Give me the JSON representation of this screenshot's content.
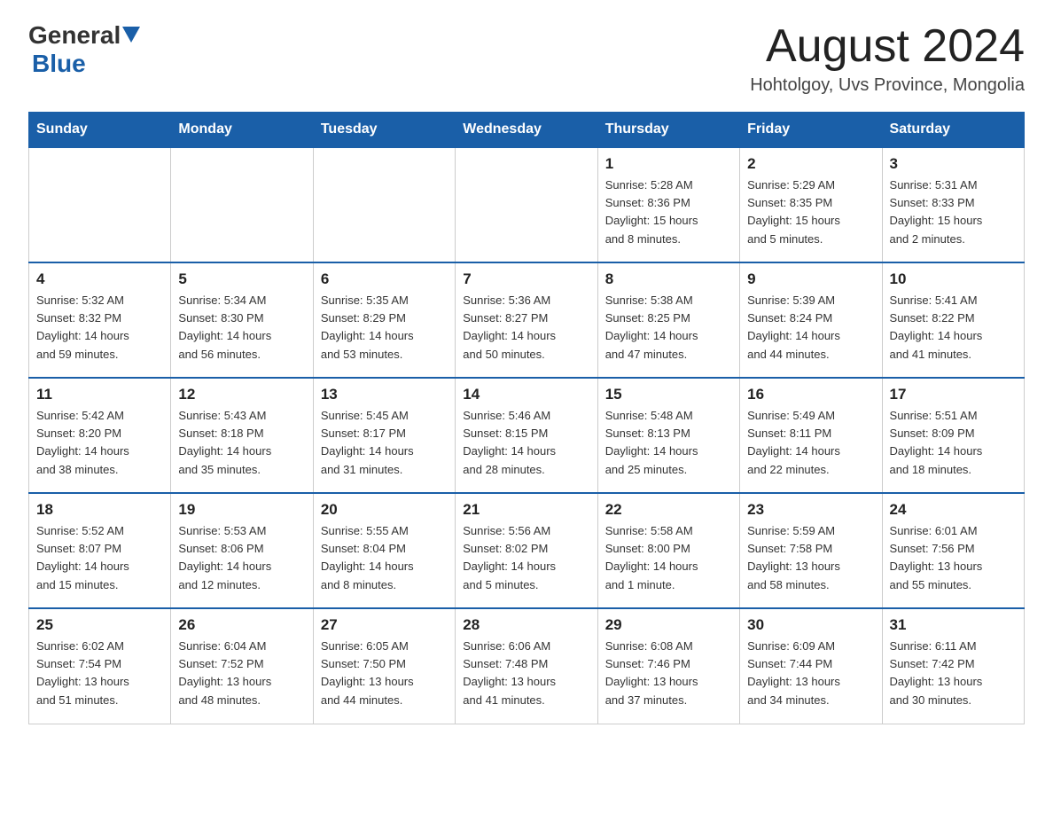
{
  "header": {
    "logo_general": "General",
    "logo_blue": "Blue",
    "month_title": "August 2024",
    "location": "Hohtolgoy, Uvs Province, Mongolia"
  },
  "columns": [
    "Sunday",
    "Monday",
    "Tuesday",
    "Wednesday",
    "Thursday",
    "Friday",
    "Saturday"
  ],
  "weeks": [
    [
      {
        "day": "",
        "info": ""
      },
      {
        "day": "",
        "info": ""
      },
      {
        "day": "",
        "info": ""
      },
      {
        "day": "",
        "info": ""
      },
      {
        "day": "1",
        "info": "Sunrise: 5:28 AM\nSunset: 8:36 PM\nDaylight: 15 hours\nand 8 minutes."
      },
      {
        "day": "2",
        "info": "Sunrise: 5:29 AM\nSunset: 8:35 PM\nDaylight: 15 hours\nand 5 minutes."
      },
      {
        "day": "3",
        "info": "Sunrise: 5:31 AM\nSunset: 8:33 PM\nDaylight: 15 hours\nand 2 minutes."
      }
    ],
    [
      {
        "day": "4",
        "info": "Sunrise: 5:32 AM\nSunset: 8:32 PM\nDaylight: 14 hours\nand 59 minutes."
      },
      {
        "day": "5",
        "info": "Sunrise: 5:34 AM\nSunset: 8:30 PM\nDaylight: 14 hours\nand 56 minutes."
      },
      {
        "day": "6",
        "info": "Sunrise: 5:35 AM\nSunset: 8:29 PM\nDaylight: 14 hours\nand 53 minutes."
      },
      {
        "day": "7",
        "info": "Sunrise: 5:36 AM\nSunset: 8:27 PM\nDaylight: 14 hours\nand 50 minutes."
      },
      {
        "day": "8",
        "info": "Sunrise: 5:38 AM\nSunset: 8:25 PM\nDaylight: 14 hours\nand 47 minutes."
      },
      {
        "day": "9",
        "info": "Sunrise: 5:39 AM\nSunset: 8:24 PM\nDaylight: 14 hours\nand 44 minutes."
      },
      {
        "day": "10",
        "info": "Sunrise: 5:41 AM\nSunset: 8:22 PM\nDaylight: 14 hours\nand 41 minutes."
      }
    ],
    [
      {
        "day": "11",
        "info": "Sunrise: 5:42 AM\nSunset: 8:20 PM\nDaylight: 14 hours\nand 38 minutes."
      },
      {
        "day": "12",
        "info": "Sunrise: 5:43 AM\nSunset: 8:18 PM\nDaylight: 14 hours\nand 35 minutes."
      },
      {
        "day": "13",
        "info": "Sunrise: 5:45 AM\nSunset: 8:17 PM\nDaylight: 14 hours\nand 31 minutes."
      },
      {
        "day": "14",
        "info": "Sunrise: 5:46 AM\nSunset: 8:15 PM\nDaylight: 14 hours\nand 28 minutes."
      },
      {
        "day": "15",
        "info": "Sunrise: 5:48 AM\nSunset: 8:13 PM\nDaylight: 14 hours\nand 25 minutes."
      },
      {
        "day": "16",
        "info": "Sunrise: 5:49 AM\nSunset: 8:11 PM\nDaylight: 14 hours\nand 22 minutes."
      },
      {
        "day": "17",
        "info": "Sunrise: 5:51 AM\nSunset: 8:09 PM\nDaylight: 14 hours\nand 18 minutes."
      }
    ],
    [
      {
        "day": "18",
        "info": "Sunrise: 5:52 AM\nSunset: 8:07 PM\nDaylight: 14 hours\nand 15 minutes."
      },
      {
        "day": "19",
        "info": "Sunrise: 5:53 AM\nSunset: 8:06 PM\nDaylight: 14 hours\nand 12 minutes."
      },
      {
        "day": "20",
        "info": "Sunrise: 5:55 AM\nSunset: 8:04 PM\nDaylight: 14 hours\nand 8 minutes."
      },
      {
        "day": "21",
        "info": "Sunrise: 5:56 AM\nSunset: 8:02 PM\nDaylight: 14 hours\nand 5 minutes."
      },
      {
        "day": "22",
        "info": "Sunrise: 5:58 AM\nSunset: 8:00 PM\nDaylight: 14 hours\nand 1 minute."
      },
      {
        "day": "23",
        "info": "Sunrise: 5:59 AM\nSunset: 7:58 PM\nDaylight: 13 hours\nand 58 minutes."
      },
      {
        "day": "24",
        "info": "Sunrise: 6:01 AM\nSunset: 7:56 PM\nDaylight: 13 hours\nand 55 minutes."
      }
    ],
    [
      {
        "day": "25",
        "info": "Sunrise: 6:02 AM\nSunset: 7:54 PM\nDaylight: 13 hours\nand 51 minutes."
      },
      {
        "day": "26",
        "info": "Sunrise: 6:04 AM\nSunset: 7:52 PM\nDaylight: 13 hours\nand 48 minutes."
      },
      {
        "day": "27",
        "info": "Sunrise: 6:05 AM\nSunset: 7:50 PM\nDaylight: 13 hours\nand 44 minutes."
      },
      {
        "day": "28",
        "info": "Sunrise: 6:06 AM\nSunset: 7:48 PM\nDaylight: 13 hours\nand 41 minutes."
      },
      {
        "day": "29",
        "info": "Sunrise: 6:08 AM\nSunset: 7:46 PM\nDaylight: 13 hours\nand 37 minutes."
      },
      {
        "day": "30",
        "info": "Sunrise: 6:09 AM\nSunset: 7:44 PM\nDaylight: 13 hours\nand 34 minutes."
      },
      {
        "day": "31",
        "info": "Sunrise: 6:11 AM\nSunset: 7:42 PM\nDaylight: 13 hours\nand 30 minutes."
      }
    ]
  ]
}
